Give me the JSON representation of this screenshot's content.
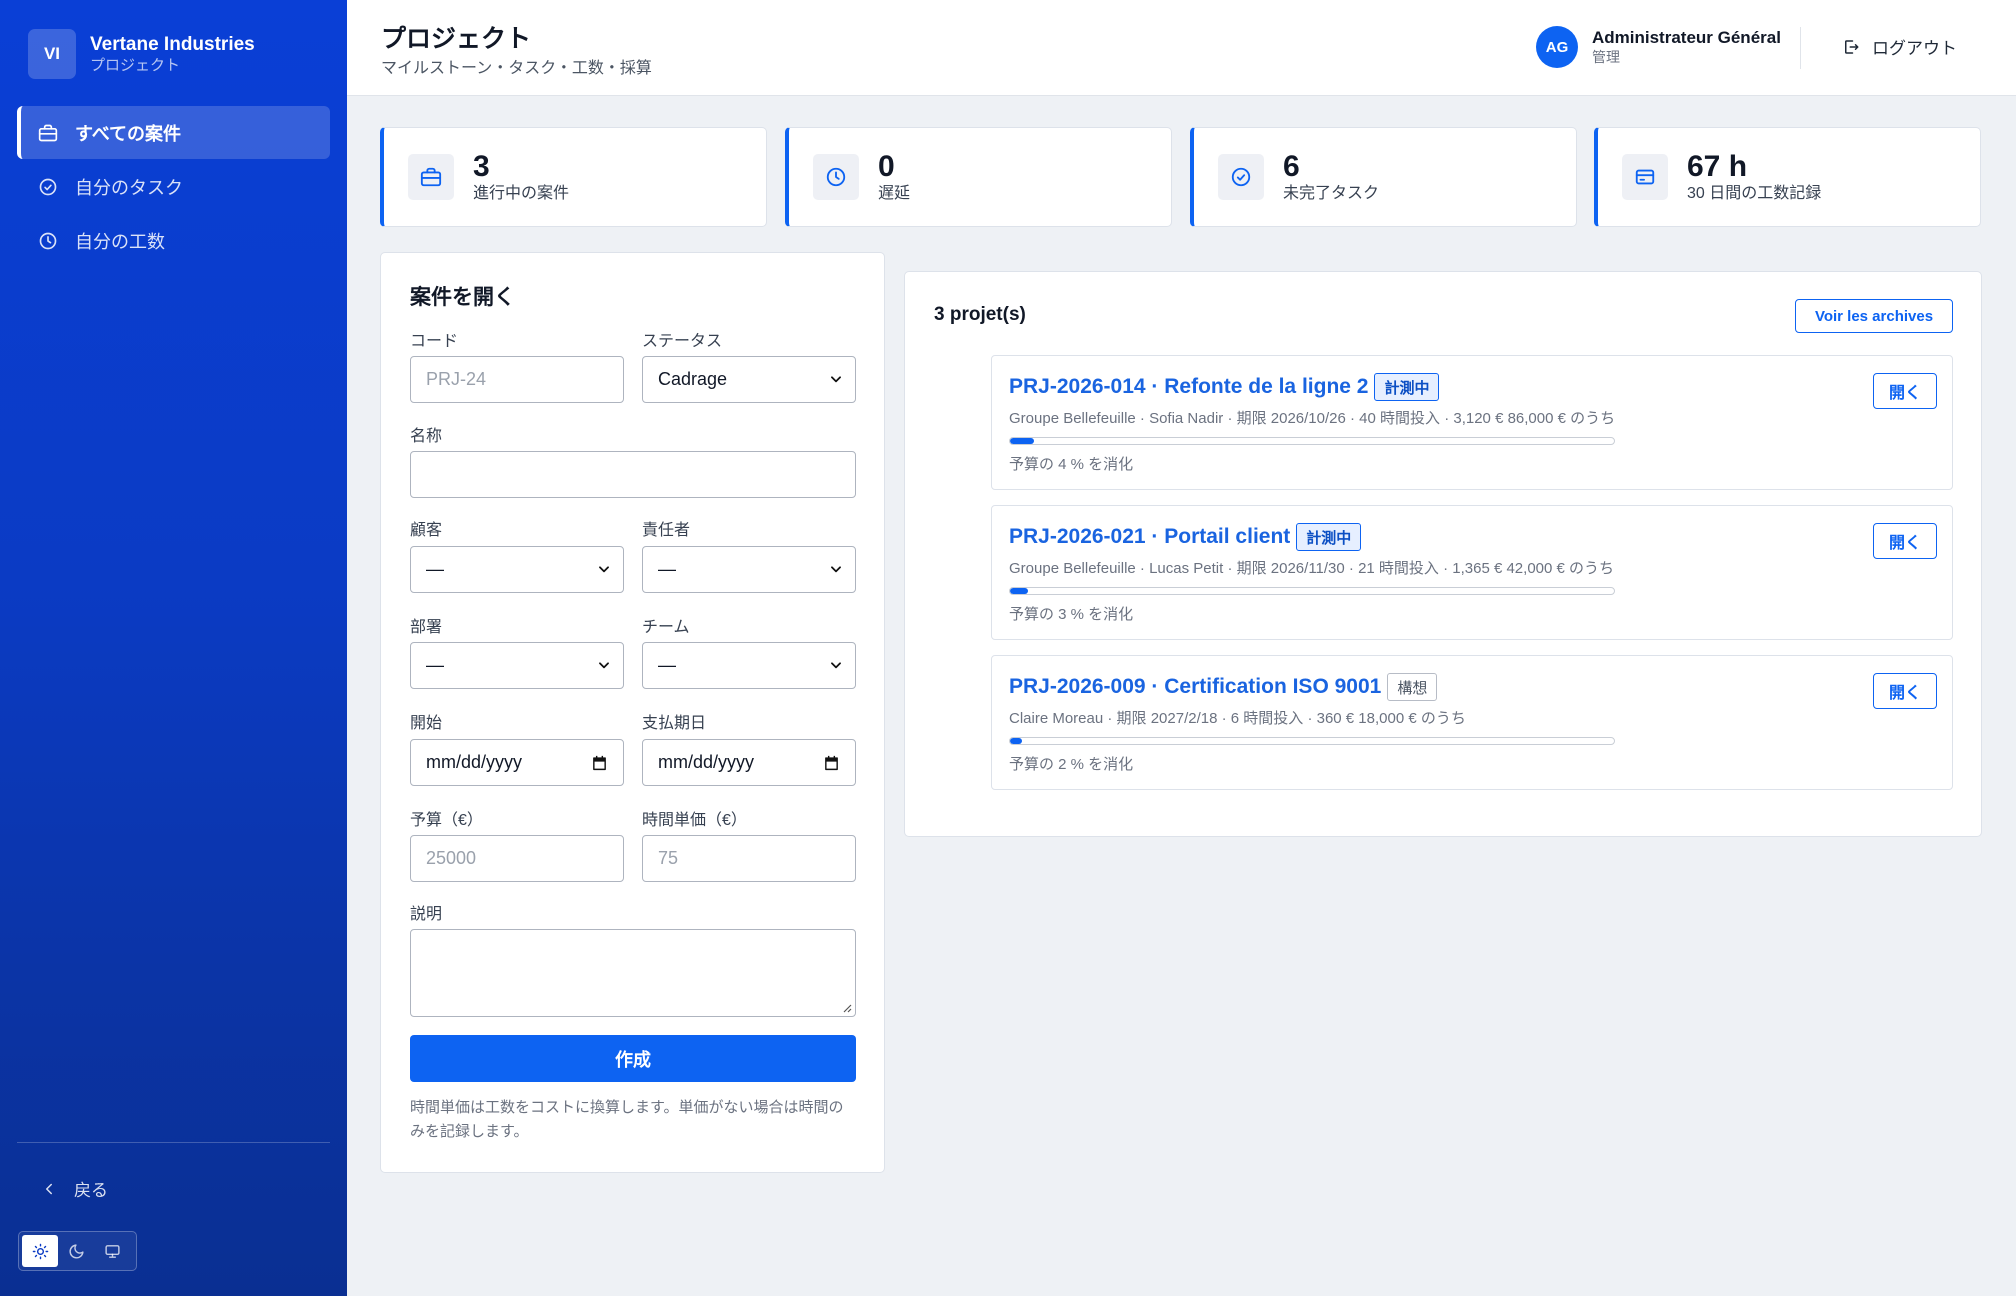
{
  "brand": {
    "logo": "VI",
    "name": "Vertane Industries",
    "subtitle": "プロジェクト"
  },
  "sidebar": {
    "items": [
      {
        "label": "すべての案件",
        "icon": "briefcase-icon",
        "active": true
      },
      {
        "label": "自分のタスク",
        "icon": "check-circle-icon",
        "active": false
      },
      {
        "label": "自分の工数",
        "icon": "clock-icon",
        "active": false
      }
    ],
    "back_label": "戻る",
    "theme": {
      "options": [
        "sun-icon",
        "moon-icon",
        "monitor-icon"
      ],
      "selected": "sun-icon"
    }
  },
  "header": {
    "title": "プロジェクト",
    "subtitle": "マイルストーン・タスク・工数・採算",
    "user": {
      "initials": "AG",
      "name": "Administrateur Général",
      "role": "管理"
    },
    "logout_label": "ログアウト"
  },
  "stats": [
    {
      "value": "3",
      "label": "進行中の案件",
      "icon": "briefcase-icon"
    },
    {
      "value": "0",
      "label": "遅延",
      "icon": "clock-icon"
    },
    {
      "value": "6",
      "label": "未完了タスク",
      "icon": "check-circle-icon"
    },
    {
      "value": "67 h",
      "label": "30 日間の工数記録",
      "icon": "card-icon"
    }
  ],
  "form": {
    "title": "案件を開く",
    "code": {
      "label": "コード",
      "placeholder": "PRJ-24"
    },
    "status": {
      "label": "ステータス",
      "value": "Cadrage"
    },
    "name": {
      "label": "名称",
      "placeholder": ""
    },
    "client": {
      "label": "顧客",
      "value": "—"
    },
    "owner": {
      "label": "責任者",
      "value": "—"
    },
    "department": {
      "label": "部署",
      "value": "—"
    },
    "team": {
      "label": "チーム",
      "value": "—"
    },
    "start": {
      "label": "開始",
      "placeholder": "mm/dd/yyyy"
    },
    "due": {
      "label": "支払期日",
      "placeholder": "mm/dd/yyyy"
    },
    "budget": {
      "label": "予算（€）",
      "placeholder": "25000"
    },
    "rate": {
      "label": "時間単価（€）",
      "placeholder": "75"
    },
    "description": {
      "label": "説明"
    },
    "submit_label": "作成",
    "hint": "時間単価は工数をコストに換算します。単価がない場合は時間のみを記録します。"
  },
  "projects": {
    "count_label": "3 projet(s)",
    "archives_label": "Voir les archives",
    "open_label": "開く",
    "items": [
      {
        "title": "PRJ-2026-014 · Refonte de la ligne 2",
        "status": "計測中",
        "status_style": "blue",
        "meta": "Groupe Bellefeuille · Sofia Nadir · 期限 2026/10/26 · 40 時間投入 · 3,120 € 86,000 € のうち",
        "progress": 4,
        "progress_label": "予算の 4 % を消化"
      },
      {
        "title": "PRJ-2026-021 · Portail client",
        "status": "計測中",
        "status_style": "blue",
        "meta": "Groupe Bellefeuille · Lucas Petit · 期限 2026/11/30 · 21 時間投入 · 1,365 € 42,000 € のうち",
        "progress": 3,
        "progress_label": "予算の 3 % を消化"
      },
      {
        "title": "PRJ-2026-009 · Certification ISO 9001",
        "status": "構想",
        "status_style": "grey",
        "meta": "Claire Moreau · 期限 2027/2/18 · 6 時間投入 · 360 € 18,000 € のうち",
        "progress": 2,
        "progress_label": "予算の 2 % を消化"
      }
    ]
  },
  "colors": {
    "primary": "#0d63f2",
    "sidebar": "#0b3bc4",
    "background": "#eef1f5"
  }
}
